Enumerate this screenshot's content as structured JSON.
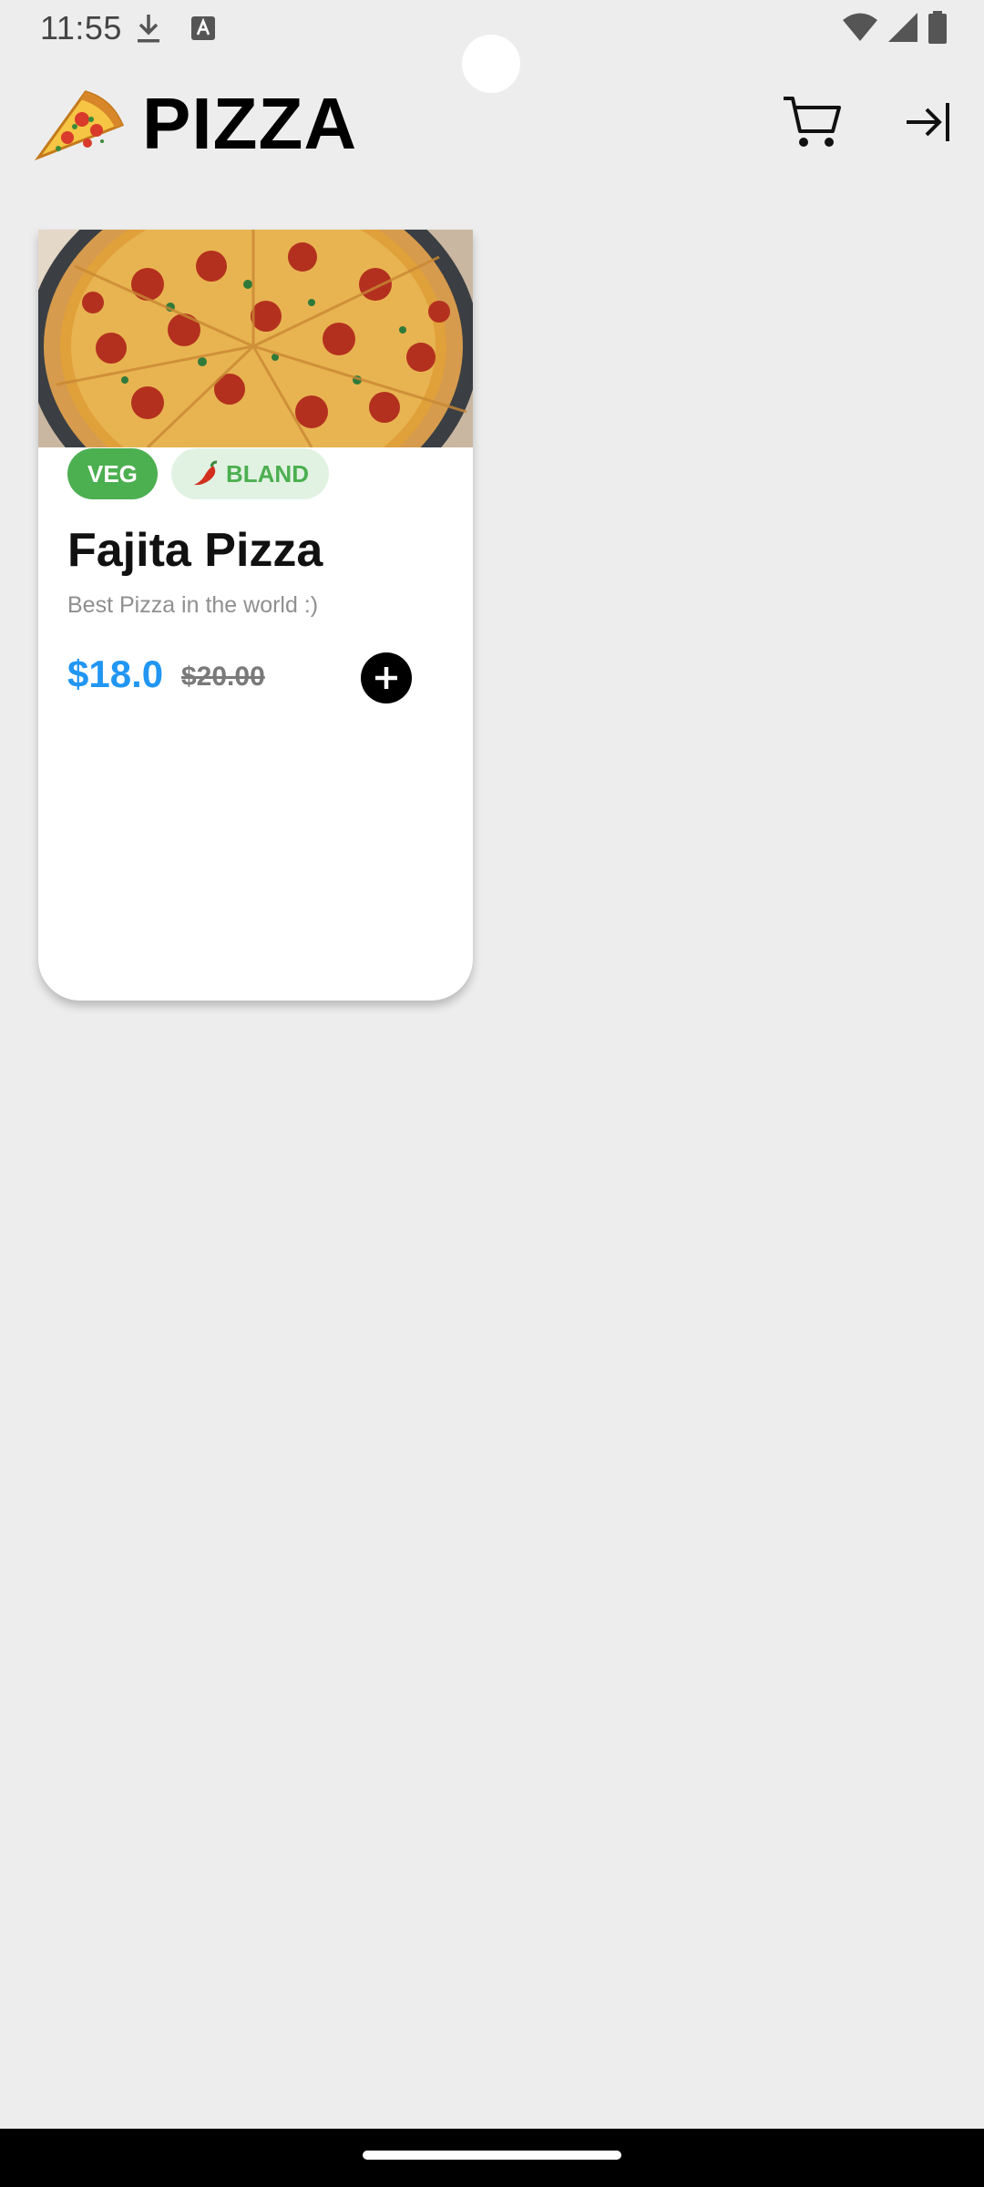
{
  "status_bar": {
    "time": "11:55",
    "icons": [
      "download-icon",
      "text-a-icon",
      "wifi-icon",
      "signal-icon",
      "battery-icon"
    ]
  },
  "app_bar": {
    "title": "PIZZA",
    "logo_icon": "pizza-slice-icon",
    "cart_icon": "cart-icon",
    "logout_icon": "logout-icon"
  },
  "products": [
    {
      "image": "pepperoni-pizza-image",
      "tags": {
        "diet": "VEG",
        "spice": "BLAND",
        "spice_icon": "chili-icon"
      },
      "name": "Fajita Pizza",
      "description": "Best Pizza in the world :)",
      "price": "$18.0",
      "old_price": "$20.00",
      "add_icon": "add-circle-icon"
    }
  ],
  "colors": {
    "background": "#ededed",
    "price": "#2196f3",
    "veg_tag": "#4caf50",
    "spice_tag_bg": "#e1f2e2",
    "card": "#ffffff"
  }
}
